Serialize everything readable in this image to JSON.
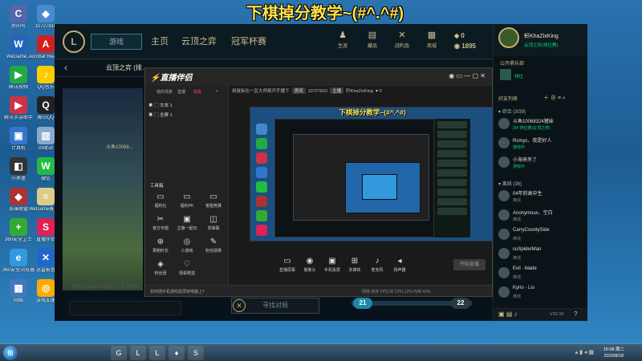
{
  "stream_title": "下棋掉分教学~(#^.^#)",
  "desktop_icons": [
    {
      "label": "房间号",
      "glyph": "C",
      "color": "#5566aa"
    },
    {
      "label": "10727810",
      "glyph": "◆",
      "color": "#4a8acc"
    },
    {
      "label": "WeGame...",
      "glyph": "W",
      "color": "#2266bb"
    },
    {
      "label": "Acrobat Reader DC",
      "glyph": "A",
      "color": "#cc2222"
    },
    {
      "label": "腾讯视频",
      "glyph": "▶",
      "color": "#22aa44"
    },
    {
      "label": "QQ音乐",
      "glyph": "♪",
      "color": "#ffcc00"
    },
    {
      "label": "腾讯手游助手",
      "glyph": "▶",
      "color": "#cc3344"
    },
    {
      "label": "腾讯QQ",
      "glyph": "Q",
      "color": "#222222"
    },
    {
      "label": "计算机",
      "glyph": "▣",
      "color": "#3377cc"
    },
    {
      "label": "回收站",
      "glyph": "▥",
      "color": "#88aacc"
    },
    {
      "label": "小黑盒",
      "glyph": "◧",
      "color": "#333333"
    },
    {
      "label": "微信",
      "glyph": "W",
      "color": "#22bb44"
    },
    {
      "label": "英雄联盟",
      "glyph": "◆",
      "color": "#aa3333"
    },
    {
      "label": "WeGame客户端",
      "glyph": "≡",
      "color": "#ddcc88"
    },
    {
      "label": "360安全卫士",
      "glyph": "+",
      "color": "#33aa33"
    },
    {
      "label": "直播伴侣",
      "glyph": "S",
      "color": "#dd2255"
    },
    {
      "label": "360安全浏览器",
      "glyph": "e",
      "color": "#3399dd"
    },
    {
      "label": "迅雷影音",
      "glyph": "✕",
      "color": "#2266cc"
    },
    {
      "label": "网络",
      "glyph": "▦",
      "color": "#4477bb"
    },
    {
      "label": "游戏加速",
      "glyph": "◎",
      "color": "#ffaa00"
    }
  ],
  "lol": {
    "logo": "L",
    "play_label": "游戏",
    "nav": [
      "主页",
      "云顶之弈",
      "冠军杯赛"
    ],
    "tools": [
      {
        "icon": "person-icon",
        "glyph": "♟",
        "label": "生涯"
      },
      {
        "icon": "chest-icon",
        "glyph": "▤",
        "label": "藏品"
      },
      {
        "icon": "swords-icon",
        "glyph": "✕",
        "label": "战利品"
      },
      {
        "icon": "store-icon",
        "glyph": "▦",
        "label": "商城"
      }
    ],
    "rp": "0",
    "be": "1895",
    "sub_title": "云顶之弈 (排...",
    "player_line": "斗鱼10068...",
    "find_match": "寻找对局",
    "score_left": "21",
    "score_right": "22",
    "chat_line": "好友KhaZixKing加入了队伍聊天"
  },
  "obs": {
    "app_name": "直播伴侣",
    "tabs": [
      "我的场景",
      "直播",
      "观看",
      "弹幕"
    ],
    "scenes": [
      "文本 1",
      "全屏 1"
    ],
    "tools_title": "工具箱",
    "tools": [
      {
        "glyph": "▭",
        "label": "福利社"
      },
      {
        "glyph": "▭",
        "label": "福利PK"
      },
      {
        "glyph": "▭",
        "label": "答题竞赛"
      },
      {
        "glyph": "✂",
        "label": "官方专题"
      },
      {
        "glyph": "▣",
        "label": "主播一起玩"
      },
      {
        "glyph": "◫",
        "label": "发弹幕"
      },
      {
        "glyph": "⊕",
        "label": "录制时长"
      },
      {
        "glyph": "◎",
        "label": "小游戏"
      },
      {
        "glyph": "✎",
        "label": "粉丝勋章"
      },
      {
        "glyph": "◈",
        "label": "粉丝团"
      },
      {
        "glyph": "♡",
        "label": "观看赠送"
      }
    ],
    "info_title": "用鼠标在一区大师局开手播下",
    "room_label": "房间",
    "room_number": "10727810",
    "host_label": "主播",
    "host_name": "轩KhaZixKing",
    "fans_count": "0",
    "preview_title": "下棋掉分教学~(#^.^#)",
    "controls": [
      {
        "glyph": "▭",
        "label": "直播屏幕"
      },
      {
        "glyph": "◉",
        "label": "摄像头"
      },
      {
        "glyph": "▣",
        "label": "手机投屏"
      },
      {
        "glyph": "⊞",
        "label": "多媒体"
      },
      {
        "glyph": "♪",
        "label": "麦克风"
      },
      {
        "glyph": "◂",
        "label": "扬声器"
      }
    ],
    "start_label": "开始直播",
    "tip": "如何把手机游戏投屏到电脑上？",
    "stats": "网络:良好   FPS:30   CPU:12%   内存:43%"
  },
  "friends": {
    "self_name": "轩KhaZixKing",
    "self_status": "云顶之弈(排位赛)",
    "club_title": "公开俱乐部",
    "club_sub": "排位",
    "list_title": "好友列表",
    "group_online": "综合 (3/39)",
    "group_offline": "离线 (36)",
    "items": [
      {
        "name": "斗鱼10068324猪妹",
        "status": "3/4 排位赛(云顶之弈)",
        "away": false
      },
      {
        "name": "Rcmyc、我是好人",
        "status": "游戏中",
        "away": false
      },
      {
        "name": "小海来杀了",
        "status": "游戏中",
        "away": false
      },
      {
        "name": "04年的高中生",
        "status": "离线",
        "away": true
      },
      {
        "name": "Anonymous、空白",
        "status": "离线",
        "away": true
      },
      {
        "name": "CarryCountySide",
        "status": "离线",
        "away": true
      },
      {
        "name": "cuSpiderMan",
        "status": "离线",
        "away": true
      },
      {
        "name": "Evil · blade",
        "status": "离线",
        "away": true
      },
      {
        "name": "Kyrio · Liu",
        "status": "离线",
        "away": true
      }
    ],
    "version": "V10.16"
  },
  "taskbar": {
    "apps": [
      "G",
      "L",
      "L",
      "♦",
      "S"
    ],
    "time": "15:08 周二",
    "date": "2020/8/18"
  }
}
